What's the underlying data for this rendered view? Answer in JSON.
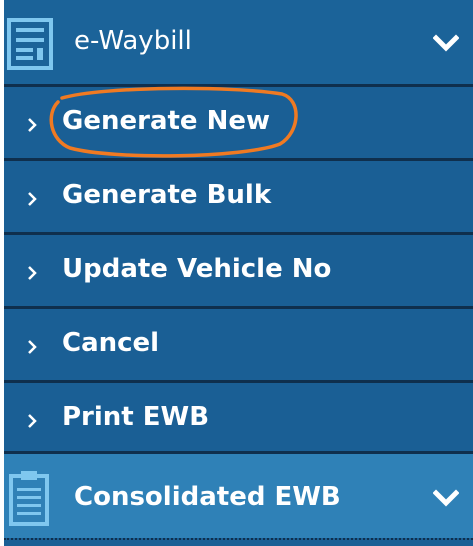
{
  "menu": {
    "header": {
      "icon": "document-list-icon",
      "title": "e-Waybill",
      "toggle_icon": "chevron-down-icon"
    },
    "items": [
      {
        "label": "Generate New",
        "icon": "chevron-right-icon"
      },
      {
        "label": "Generate Bulk",
        "icon": "chevron-right-icon"
      },
      {
        "label": "Update Vehicle No",
        "icon": "chevron-right-icon"
      },
      {
        "label": "Cancel",
        "icon": "chevron-right-icon"
      },
      {
        "label": "Print EWB",
        "icon": "chevron-right-icon"
      }
    ],
    "section2": {
      "icon": "clipboard-icon",
      "title": "Consolidated EWB",
      "toggle_icon": "chevron-down-icon"
    },
    "colors": {
      "menu_bg": "#1a5f95",
      "section2_bg": "#2f81b7",
      "divider": "#0f2f4d",
      "highlight": "#f07a22"
    }
  }
}
